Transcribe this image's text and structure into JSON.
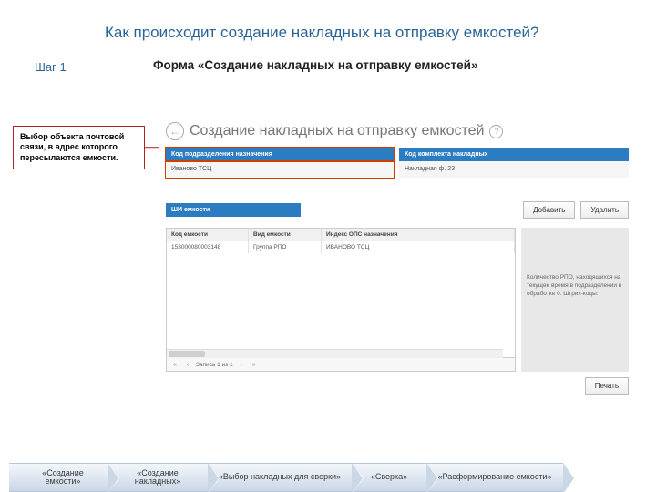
{
  "slide": {
    "title": "Как происходит создание накладных на отправку емкостей?",
    "step": "Шаг 1",
    "formTitle": "Форма «Создание накладных на отправку емкостей»"
  },
  "callout": "Выбор объекта почтовой связи, в адрес которого пересылаются емкости.",
  "app": {
    "headerTitle": "Создание накладных на отправку емкостей",
    "leftPane": {
      "header": "Код подразделения назначения",
      "value": "Иваново ТСЦ"
    },
    "rightPane": {
      "header": "Код комплекта накладных",
      "value": "Накладная ф. 23"
    },
    "barcodeHeader": "ШИ емкости",
    "buttons": {
      "add": "Добавить",
      "delete": "Удалить",
      "print": "Печать"
    },
    "grid": {
      "cols": [
        "Код емкости",
        "Вид емкости",
        "Индекс ОПС назначения"
      ],
      "row": [
        "153000080003148",
        "Группа РПО",
        "ИВАНОВО ТСЦ"
      ],
      "footer": "Запись 1 из 1"
    },
    "sideInfo": "Количество РПО, находящихся на текущее время в подразделении в обработке 0. Штрих-коды:"
  },
  "arrows": [
    "«Создание емкости»",
    "«Создание накладных»",
    "«Выбор накладных для сверки»",
    "«Сверка»",
    "«Расформирование емкости»"
  ]
}
